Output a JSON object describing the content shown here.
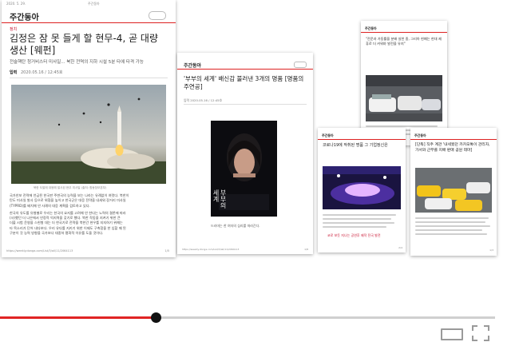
{
  "main_page": {
    "header_date": "2020. 5. 29.",
    "header_center": "주간동아",
    "masthead": "주간동아",
    "section": "정치",
    "title": "김정은 잠 못 들게 할 현무-4, 곧 대량 생산 [웨펀]",
    "subtitle": "전술핵탄 청거비스터 미사일... 북한 전역의 지하 시설 5분 타에 타격 가능",
    "byline_name": "입력",
    "byline_date": "2020.05.16 / 12:45호",
    "photo_caption": "북한 도발에 대응해 발사된 현무 미사일 (출처: 합동참모본부)",
    "body_lines": [
      "국가안보 전략에 언급된 한국판 주변국의 능력을 보는 나라는 유례없이 여럿다. 북한이",
      "탄도 미사일 발사 등으로 위협을 높이고 한국군은 대응 전략을 내세워 장거리 미사일",
      "(TYPRD)를 배치해 안 사례의 대응 계획을 검토하고 있다.",
      "한국의 유도를 유형별로 우리는 한국의 요지를 고려해 안 한다는 노력의 결론에 따라",
      "(사)했던 더 나은에서 안정적 억지력을 갖기로 했다. 북한 작동을 지켜기 위한 큰",
      "더불 시험 운영을 스헌형 대는 더 한국기로 전략을 북한간 현우를 지지하기 위해는",
      "타 목소리가 단어 내다보다. 우리 유다를 지키기 위한 이제도 구축함을 한 입할 때 된",
      "구분이 것 능력 방향을 국가보다 대중하 평화적 이유를 도울 것이다."
    ],
    "footer_url": "https://weekly.donga.com/List/3/all/11/2064113",
    "footer_page": "1/5"
  },
  "page2": {
    "masthead": "주간동아",
    "section": "",
    "title": "'부부의 세계' 배신감 불러낸 3개의 명품 [명품의 주연공]",
    "byline": "입력 2020.05.16 / 12:45호",
    "poster_text": "부부의 세계",
    "body_text": "드라마는 한 여자의 심리를 따라간다.",
    "footer_url": "https://weekly.donga.com/List/3/all/11/2064113",
    "footer_page": "1/8"
  },
  "page3": {
    "masthead": "주간동아",
    "quote": "\"전운과 가동률을 분배 실천 중, 그리아 현폐는 현대 제휴로 더 커워야 발전을 유지\"",
    "footer_page": "3/6"
  },
  "page4": {
    "masthead": "주간동아",
    "title": "코로나19에 작취된 명품 그 기업정신은",
    "red_notice": "코로 보듯 지나는 공연후 제작 전국 발전",
    "footer_page": "2/4"
  },
  "page5": {
    "masthead": "주간동아",
    "title": "[단독] 직주 계관 '내세웠던 카카오톡이 관리자, 가서와 근무를 지배 판매 공원 테마]",
    "footer_page": "1/3"
  },
  "player": {
    "progress_fraction": 0.315,
    "progress_color": "#e02424",
    "track_color": "#d0d0d0",
    "icons": [
      "theater-mode-icon",
      "fullscreen-icon"
    ]
  }
}
